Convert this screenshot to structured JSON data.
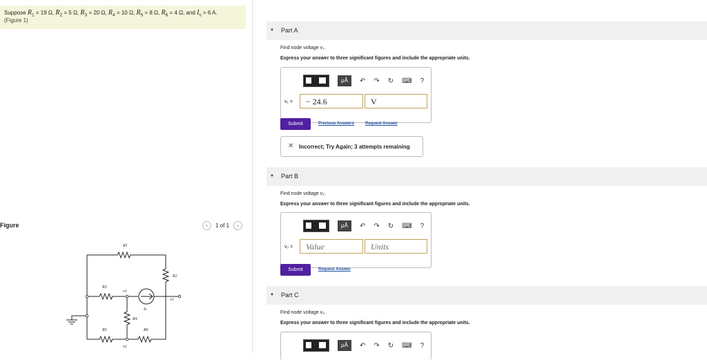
{
  "problem": {
    "suppose": "Suppose",
    "r1_name": "R",
    "r1_sub": "1",
    "r1_value": "= 19 Ω,",
    "r2_name": "R",
    "r2_sub": "2",
    "r2_value": "= 5 Ω,",
    "r3_name": "R",
    "r3_sub": "3",
    "r3_value": "= 20 Ω,",
    "r4_name": "R",
    "r4_sub": "4",
    "r4_value": "= 10 Ω,",
    "r5_name": "R",
    "r5_sub": "5",
    "r5_value": "= 8 Ω,",
    "r6_name": "R",
    "r6_sub": "6",
    "r6_value": "= 4 Ω, and",
    "is_name": "I",
    "is_sub": "s",
    "is_value": "= 6 A.",
    "figure_link": "(Figure 1)"
  },
  "figure": {
    "title": "Figure",
    "pager": "1 of 1",
    "prev": "‹",
    "next": "›",
    "labels": {
      "r1": "R1",
      "r2": "R2",
      "r3": "R3",
      "r4": "R4",
      "r5": "R5",
      "r6": "R6",
      "v1": "v1",
      "v2": "v2",
      "v3": "v3",
      "is": "Is"
    }
  },
  "toolbar": {
    "mu": "μÅ",
    "undo": "↶",
    "redo": "↷",
    "reset": "↻",
    "keyboard": "⌨",
    "help": "?"
  },
  "partA": {
    "title": "Part A",
    "find": "Find node voltage v₁.",
    "instructions": "Express your answer to three significant figures and include the appropriate units.",
    "var_label": "v₁ =",
    "value": "− 24.6",
    "units": "V",
    "submit": "Submit",
    "previous_answers": "Previous Answers",
    "request_answer": "Request Answer",
    "feedback": "Incorrect; Try Again; 3 attempts remaining",
    "feedback_icon": "✕"
  },
  "partB": {
    "title": "Part B",
    "find": "Find node voltage v₂.",
    "instructions": "Express your answer to three significant figures and include the appropriate units.",
    "var_label": "v₂ =",
    "value_placeholder": "Value",
    "units_placeholder": "Units",
    "submit": "Submit",
    "request_answer": "Request Answer"
  },
  "partC": {
    "title": "Part C",
    "find": "Find node voltage v₃.",
    "instructions": "Express your answer to three significant figures and include the appropriate units."
  },
  "colors": {
    "submit": "#5020a0",
    "link": "#2050a0",
    "band": "#f0f0f0",
    "problem_bg": "#f5f5dc"
  },
  "icons": {
    "collapse": "triangle-down-icon"
  }
}
